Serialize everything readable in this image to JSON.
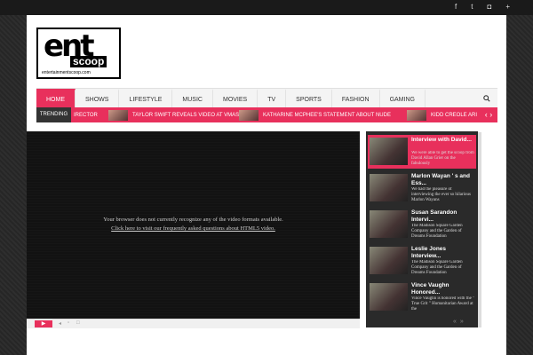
{
  "social": [
    "f",
    "t",
    "◘",
    "+"
  ],
  "logo": {
    "main": "ent",
    "sub": "scoop",
    "url": "entertainmentscoop.com"
  },
  "nav": {
    "items": [
      {
        "label": "HOME",
        "active": true
      },
      {
        "label": "SHOWS"
      },
      {
        "label": "LIFESTYLE"
      },
      {
        "label": "MUSIC"
      },
      {
        "label": "MOVIES"
      },
      {
        "label": "TV"
      },
      {
        "label": "SPORTS"
      },
      {
        "label": "FASHION"
      },
      {
        "label": "GAMING"
      }
    ]
  },
  "trending": {
    "label": "TRENDING",
    "items": [
      "IRECTOR",
      "TAYLOR SWIFT REVEALS VIDEO AT VMAS",
      "KATHARINE MCPHEE'S STATEMENT ABOUT NUDE",
      "KIDD CREOLE ARI"
    ],
    "arrows": "‹ ›"
  },
  "video": {
    "message": "Your browser does not currently recognize any of the video formats available.",
    "link": "Click here to visit our frequently asked questions about HTML5 video."
  },
  "playlist": [
    {
      "title": "Interview with David...",
      "desc": "We were able to get the scoop from David Allan Grier on the fabulously",
      "active": true
    },
    {
      "title": "Marlon Wayan ' s and Ess...",
      "desc": "We had the pleasure of interviewing the ever so hilarious Marlon Wayans"
    },
    {
      "title": "Susan Sarandon Intervi...",
      "desc": "The Madison Square Garden Company and the Garden of Dreams Foundation"
    },
    {
      "title": "Leslie Jones Interview...",
      "desc": "The Madison Square Garden Company and the Garden of Dreams Foundation"
    },
    {
      "title": "Vince Vaughn Honored...",
      "desc": "Vince Vaughn is honored with the \" True Grit \" Humanitarian Award at the"
    }
  ]
}
